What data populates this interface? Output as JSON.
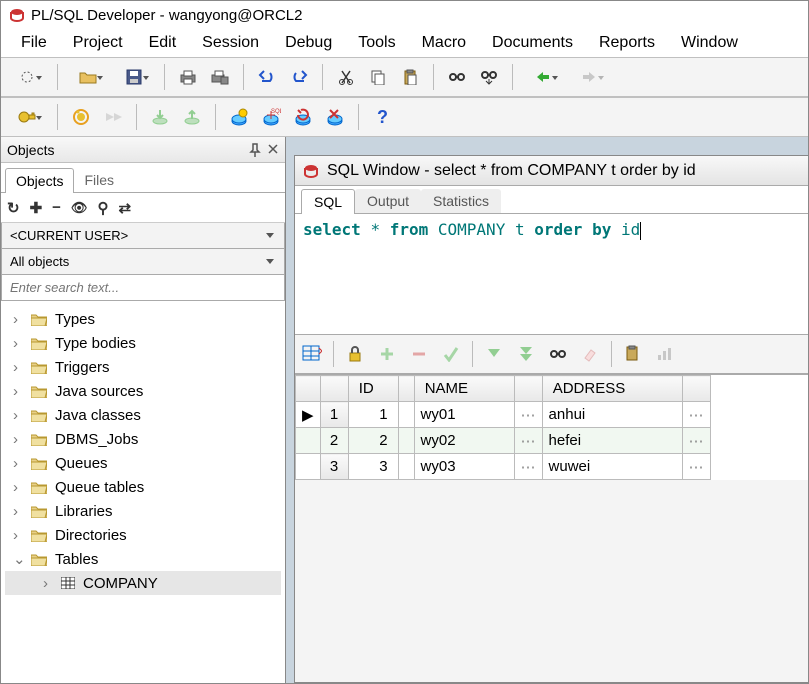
{
  "app": {
    "title": "PL/SQL Developer - wangyong@ORCL2"
  },
  "menu": [
    "File",
    "Project",
    "Edit",
    "Session",
    "Debug",
    "Tools",
    "Macro",
    "Documents",
    "Reports",
    "Window"
  ],
  "objects_panel": {
    "title": "Objects",
    "tabs": [
      "Objects",
      "Files"
    ],
    "user_combo": "<CURRENT USER>",
    "filter_combo": "All objects",
    "search_placeholder": "Enter search text...",
    "tree": [
      {
        "label": "Types",
        "expanded": false
      },
      {
        "label": "Type bodies",
        "expanded": false
      },
      {
        "label": "Triggers",
        "expanded": false
      },
      {
        "label": "Java sources",
        "expanded": false
      },
      {
        "label": "Java classes",
        "expanded": false
      },
      {
        "label": "DBMS_Jobs",
        "expanded": false
      },
      {
        "label": "Queues",
        "expanded": false
      },
      {
        "label": "Queue tables",
        "expanded": false
      },
      {
        "label": "Libraries",
        "expanded": false
      },
      {
        "label": "Directories",
        "expanded": false
      },
      {
        "label": "Tables",
        "expanded": true
      }
    ],
    "table_children": [
      "COMPANY"
    ]
  },
  "sql_window": {
    "title": "SQL Window - select * from COMPANY t order by id",
    "tabs": [
      "SQL",
      "Output",
      "Statistics"
    ],
    "active_tab": "SQL",
    "sql_tokens": [
      {
        "t": "select",
        "k": "kw"
      },
      {
        "t": " "
      },
      {
        "t": "*",
        "k": "op"
      },
      {
        "t": " "
      },
      {
        "t": "from",
        "k": "kw"
      },
      {
        "t": " "
      },
      {
        "t": "COMPANY",
        "k": "ident"
      },
      {
        "t": " "
      },
      {
        "t": "t",
        "k": "ident"
      },
      {
        "t": " "
      },
      {
        "t": "order",
        "k": "kw"
      },
      {
        "t": " "
      },
      {
        "t": "by",
        "k": "kw"
      },
      {
        "t": " "
      },
      {
        "t": "id",
        "k": "ident"
      }
    ],
    "columns": [
      "ID",
      "NAME",
      "ADDRESS"
    ],
    "rows": [
      {
        "n": "1",
        "id": "1",
        "name": "wy01",
        "address": "anhui"
      },
      {
        "n": "2",
        "id": "2",
        "name": "wy02",
        "address": "hefei"
      },
      {
        "n": "3",
        "id": "3",
        "name": "wy03",
        "address": "wuwei"
      }
    ]
  }
}
